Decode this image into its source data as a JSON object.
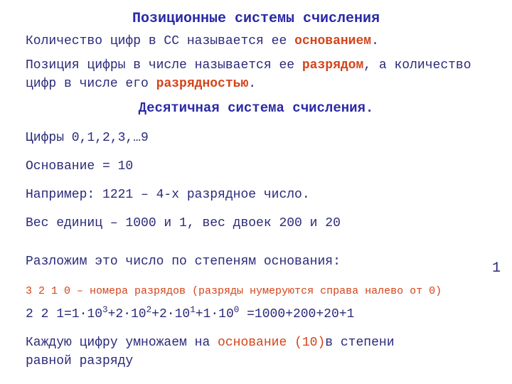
{
  "title": "Позиционные системы счисления",
  "p1_a": "Количество цифр в СС называется ее ",
  "p1_b": "основанием",
  "p1_c": ".",
  "p2_a": "Позиция цифры в числе называется ее ",
  "p2_b": "разрядом",
  "p2_c": ", а количество цифр в числе его ",
  "p2_d": "разрядностью",
  "p2_e": ".",
  "subtitle": "Десятичная система счисления.",
  "digits": "Цифры 0,1,2,3,…9",
  "base": "Основание = 10",
  "example": "Например: 1221 – 4-х разрядное число.",
  "weights": "Вес единиц – 1000 и 1, вес двоек 200 и 20",
  "decompose": "Разложим это число по степеням основания:",
  "positions": "3  2  1  0 – номера разрядов (разряды нумеруются справа налево от 0)",
  "expansion_lead": "2 2 1=1·10",
  "exp3": "3",
  "e1": "+2·10",
  "exp2": "2",
  "e2": "+2·10",
  "exp1": "1",
  "e3": "+1·10",
  "exp0": "0",
  "expansion_tail": " =1000+200+20+1",
  "final_a": "Каждую цифру умножаем на ",
  "final_b": "основание (10)",
  "final_c": "в степени",
  "final_d": "равной разряду",
  "corner": "1"
}
